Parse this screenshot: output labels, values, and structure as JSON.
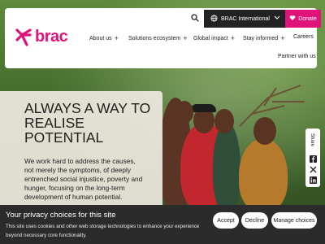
{
  "header": {
    "logo_text": "brac",
    "international_label": "BRAC International",
    "donate_label": "Donate",
    "nav": [
      {
        "label": "About us"
      },
      {
        "label": "Solutions ecosystem"
      },
      {
        "label": "Global impact"
      },
      {
        "label": "Stay informed"
      },
      {
        "label": "Careers"
      }
    ],
    "partner_label": "Partner with us",
    "colors": {
      "brand": "#e0137b",
      "dark": "#222222"
    }
  },
  "hero": {
    "headline": "ALWAYS A WAY TO REALISE POTENTIAL",
    "body": "We work hard to address the causes, not merely the symptoms, of deeply entrenched social injustice, poverty and hunger, focusing on the long-term development of human potential."
  },
  "share": {
    "label": "Share",
    "icons": [
      "facebook-icon",
      "x-icon",
      "linkedin-icon"
    ]
  },
  "cookie": {
    "title": "Your privacy choices for this site",
    "text": "This site uses cookies and other web storage technologies to enhance your experience beyond necessary core functionality.",
    "accept_label": "Accept",
    "decline_label": "Decline",
    "manage_label": "Manage choices"
  }
}
